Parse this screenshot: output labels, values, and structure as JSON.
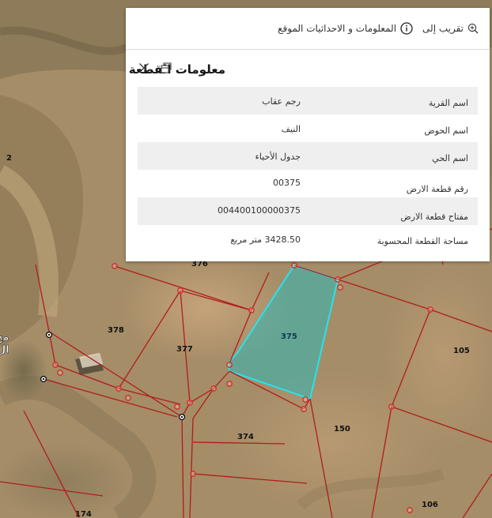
{
  "map": {
    "plot_labels": [
      "375",
      "376",
      "377",
      "378",
      "374",
      "150",
      "105",
      "106",
      "174",
      "2"
    ],
    "edge_labels": [
      "مح",
      "ال"
    ],
    "colors": {
      "parcel_line": "#b01d1d",
      "selected_outline": "#27e3ee",
      "selected_fill": "#2fb8b6",
      "vertex": "#d42b2b"
    }
  },
  "popup": {
    "actions": {
      "info_label": "المعلومات و الاحداثيات الموقع",
      "info_icon": "info-circle-icon",
      "zoom_label": "تقريب إلى",
      "zoom_icon": "zoom-in-icon"
    },
    "title": "معلومات القطعة",
    "close_icon": "close-icon",
    "dock_icon": "dock-icon",
    "rows": [
      {
        "label": "اسم القرية",
        "value": "رجم عقاب"
      },
      {
        "label": "اسم الحوض",
        "value": "النيف"
      },
      {
        "label": "اسم الحي",
        "value": "جدول الأحياء"
      },
      {
        "label": "رقم قطعة الارض",
        "value": "00375"
      },
      {
        "label": "مفتاح قطعة الارض",
        "value": "004400100000375"
      },
      {
        "label": "مساحة القطعة المحسوبة",
        "value": "3428.50 متر مربع"
      }
    ]
  }
}
